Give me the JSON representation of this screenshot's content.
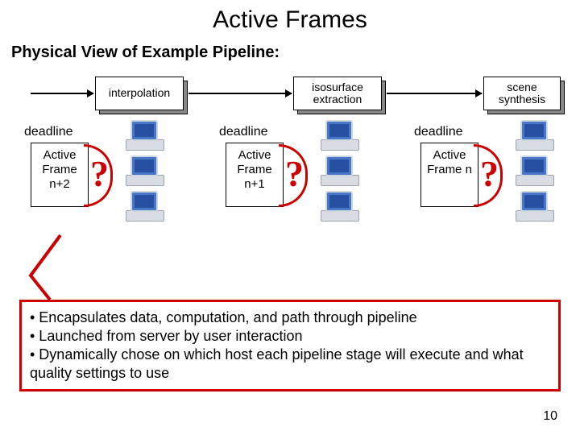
{
  "title": "Active Frames",
  "subtitle": "Physical View of Example Pipeline:",
  "stages": {
    "s1": "interpolation",
    "s2": "isosurface extraction",
    "s3": "scene synthesis"
  },
  "clusters": {
    "deadline_label": "deadline",
    "question": "?",
    "c1": "Active Frame n+2",
    "c2": "Active Frame n+1",
    "c3": "Active Frame n"
  },
  "bullets": {
    "b1": "• Encapsulates data, computation, and path through pipeline",
    "b2": "• Launched from server by user interaction",
    "b3": "• Dynamically chose on which host each pipeline stage will execute and what quality settings to use"
  },
  "page_number": "10"
}
